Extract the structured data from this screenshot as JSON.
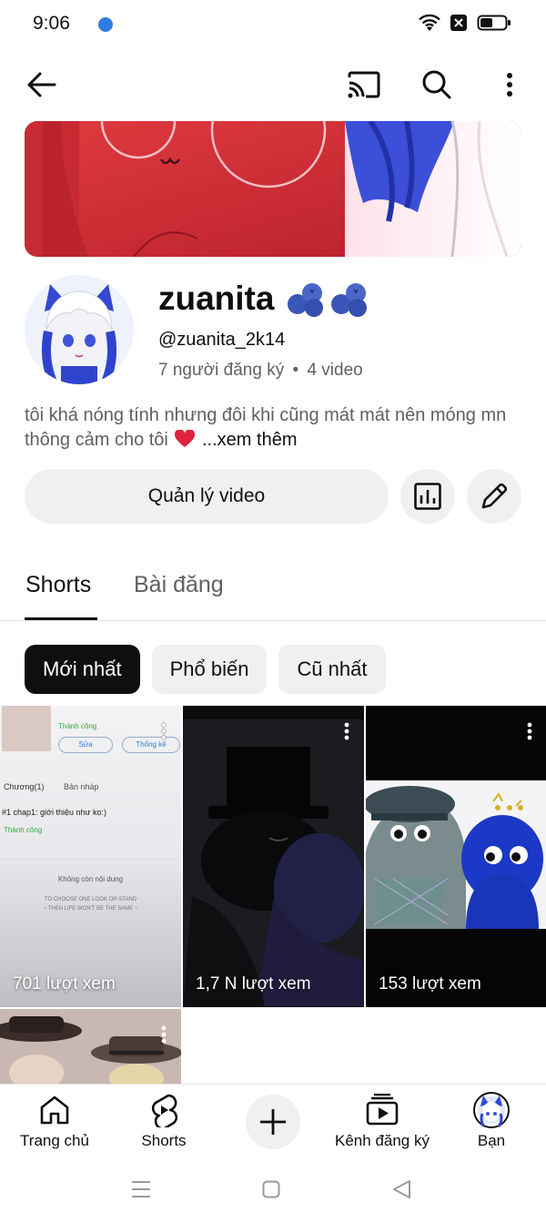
{
  "status": {
    "time": "9:06"
  },
  "channel": {
    "name": "zuanita",
    "handle": "@zuanita_2k14",
    "subscribers": "7 người đăng ký",
    "separator": "•",
    "videos": "4 video",
    "bio": "tôi khá nóng tính nhưng đôi khi cũng mát mát nên móng mn thông cảm cho tôi",
    "more_label": "...xem thêm"
  },
  "actions": {
    "manage_label": "Quản lý video"
  },
  "tabs": [
    {
      "label": "Shorts",
      "active": true
    },
    {
      "label": "Bài đăng",
      "active": false
    }
  ],
  "filters": [
    {
      "label": "Mới nhất",
      "selected": true
    },
    {
      "label": "Phổ biến",
      "selected": false
    },
    {
      "label": "Cũ nhất",
      "selected": false
    }
  ],
  "shorts": [
    {
      "views": "701 lượt xem"
    },
    {
      "views": "1,7 N lượt xem"
    },
    {
      "views": "153 lượt xem"
    },
    {
      "views": ""
    }
  ],
  "thumb1": {
    "status_ok": "Thành công",
    "edit": "Sửa",
    "stats": "Thống kê",
    "chapter_tab": "Chương(1)",
    "draft_tab": "Bản nháp",
    "chapter_title": "#1  chap1: giới thiệu như ko:)",
    "chapter_status": "Thành công",
    "no_content": "Không còn nội dung",
    "quote1": "TO CHOOSE ONE LOOK OR STAND",
    "quote2": "~ THEN LIFE WON'T BE THE SAME ~"
  },
  "bottom_nav": [
    {
      "label": "Trang chủ",
      "icon": "home-icon"
    },
    {
      "label": "Shorts",
      "icon": "shorts-icon"
    },
    {
      "label": "",
      "icon": "plus-icon"
    },
    {
      "label": "Kênh đăng ký",
      "icon": "subscriptions-icon"
    },
    {
      "label": "Bạn",
      "icon": "avatar-icon"
    }
  ],
  "colors": {
    "text": "#0f0f0f",
    "secondary": "#606060",
    "chip_bg": "#f0f0f0",
    "heart": "#e0233c"
  }
}
